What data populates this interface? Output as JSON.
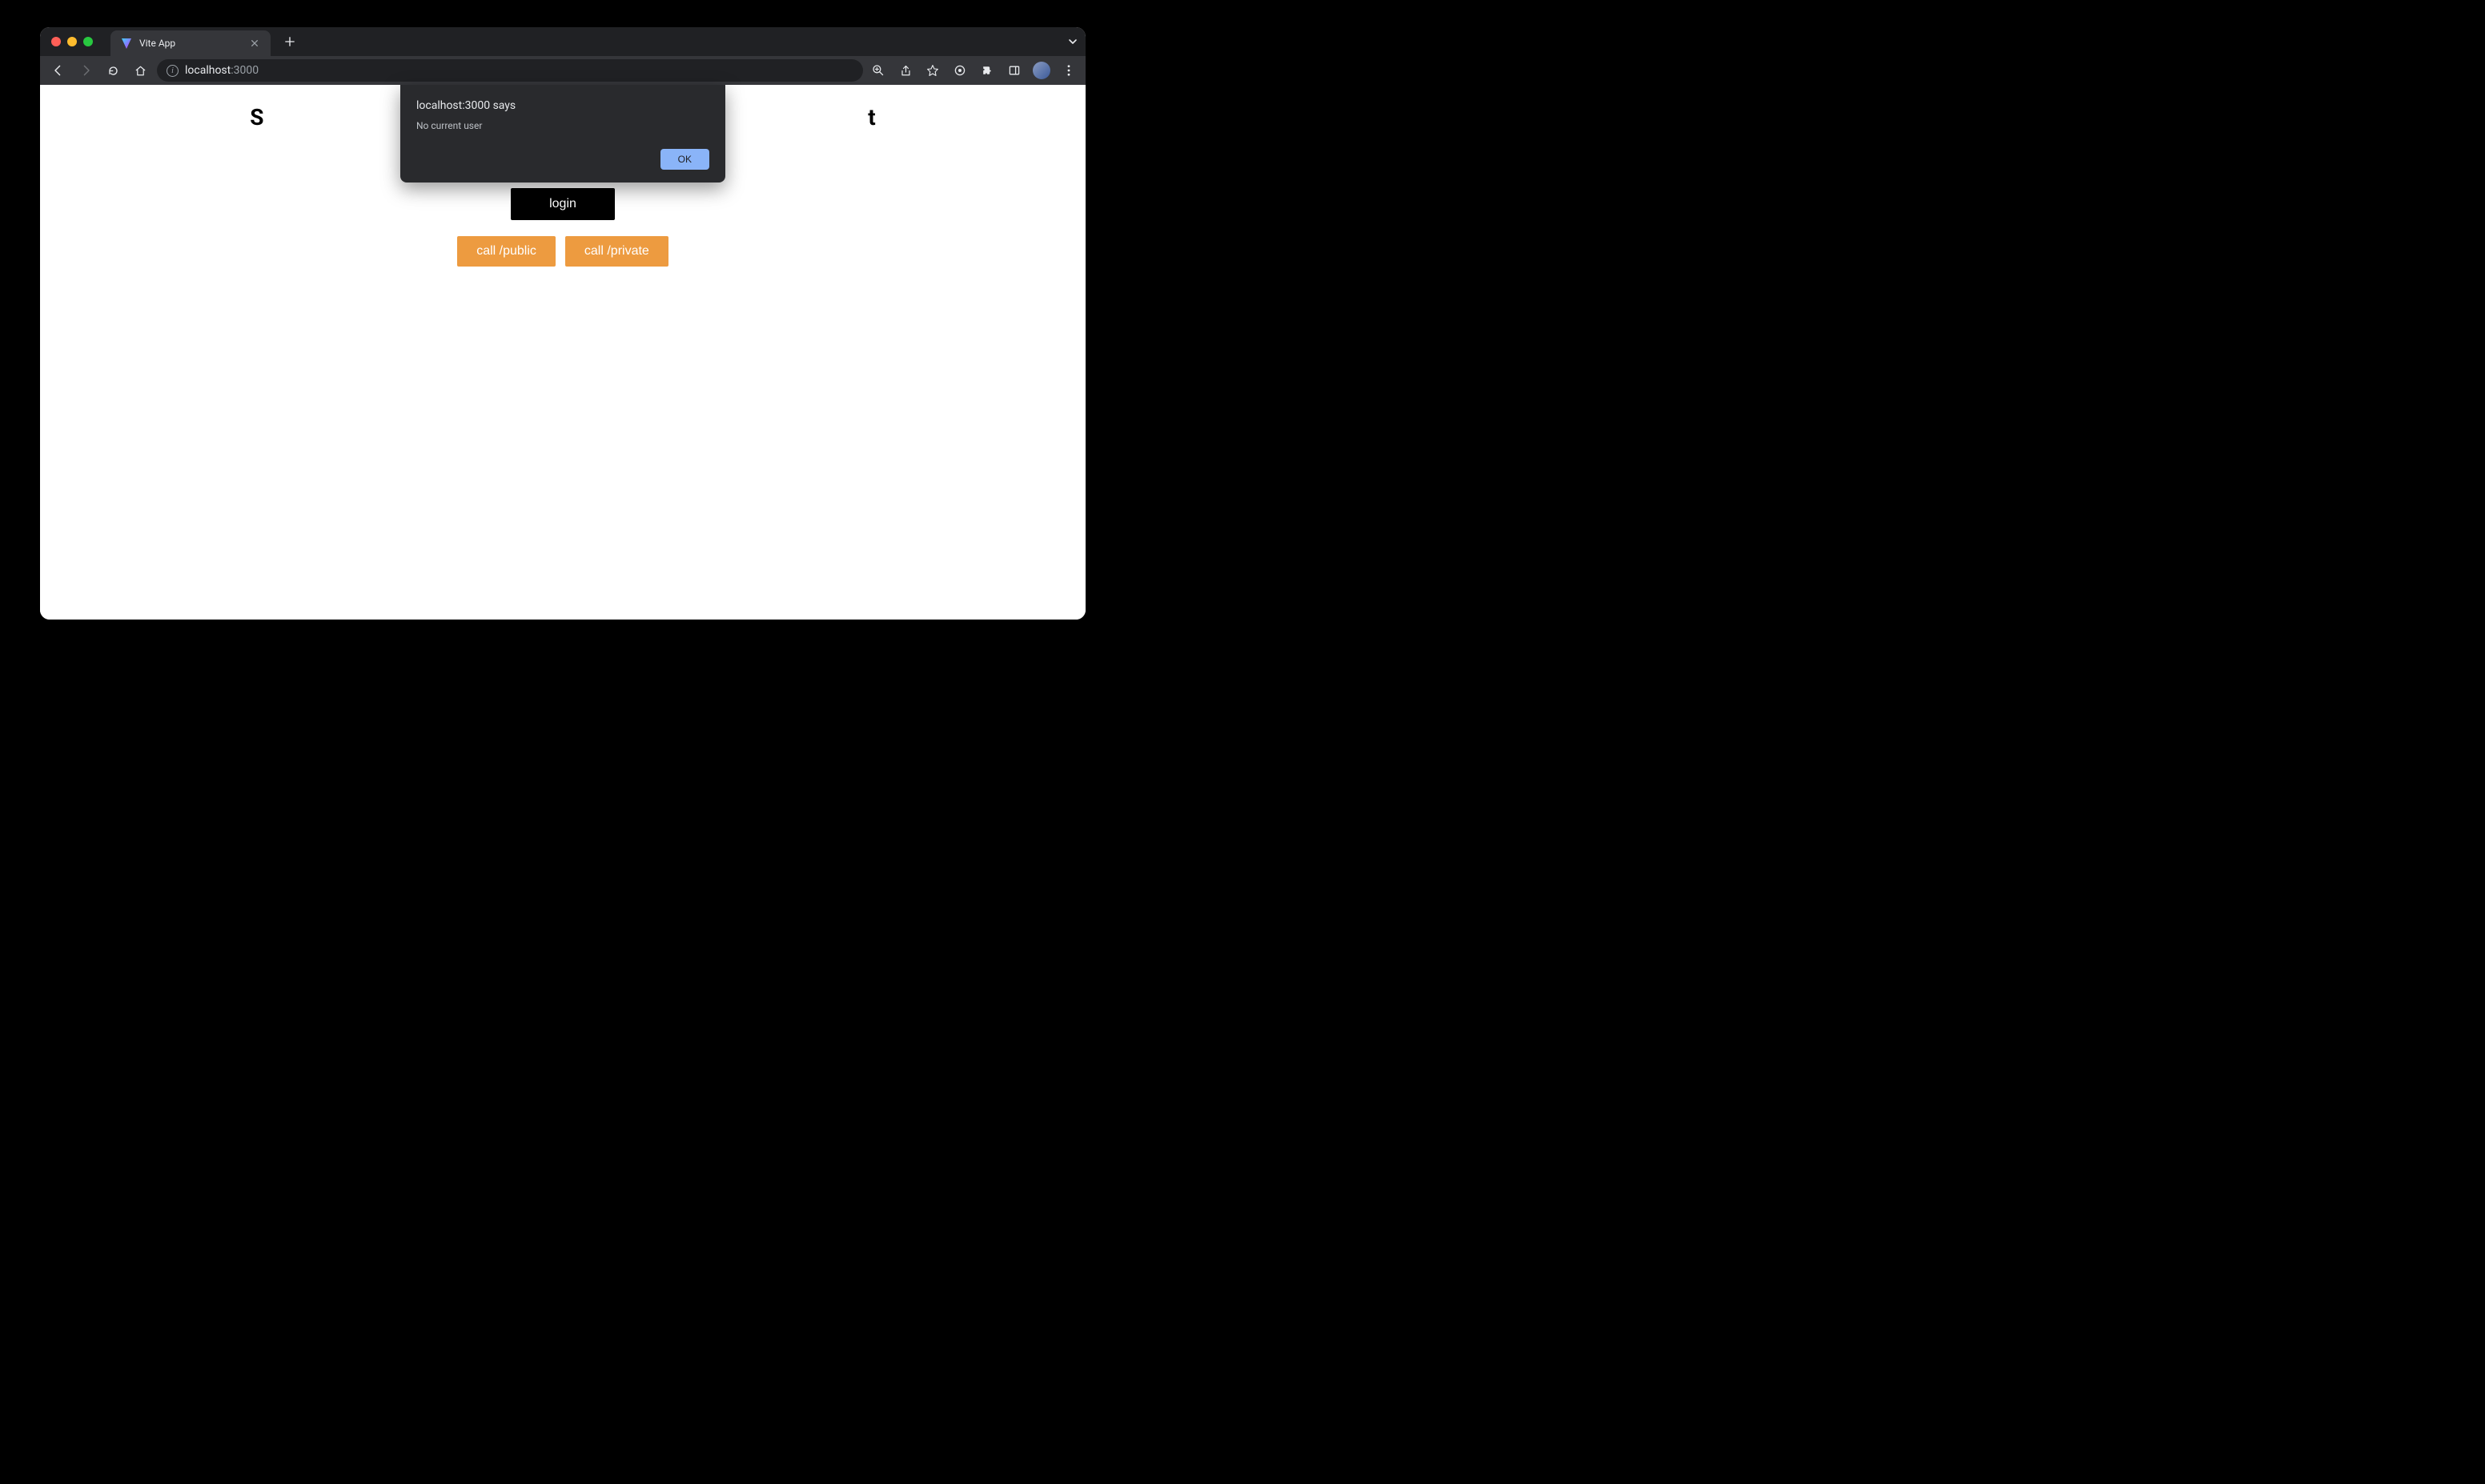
{
  "browser": {
    "tab_title": "Vite App",
    "url_host": "localhost",
    "url_path": ":3000"
  },
  "page": {
    "heading_prefix": "S",
    "heading_suffix": "t",
    "login_label": "login",
    "call_public_label": "call /public",
    "call_private_label": "call /private"
  },
  "alert": {
    "title": "localhost:3000 says",
    "message": "No current user",
    "ok_label": "OK"
  }
}
